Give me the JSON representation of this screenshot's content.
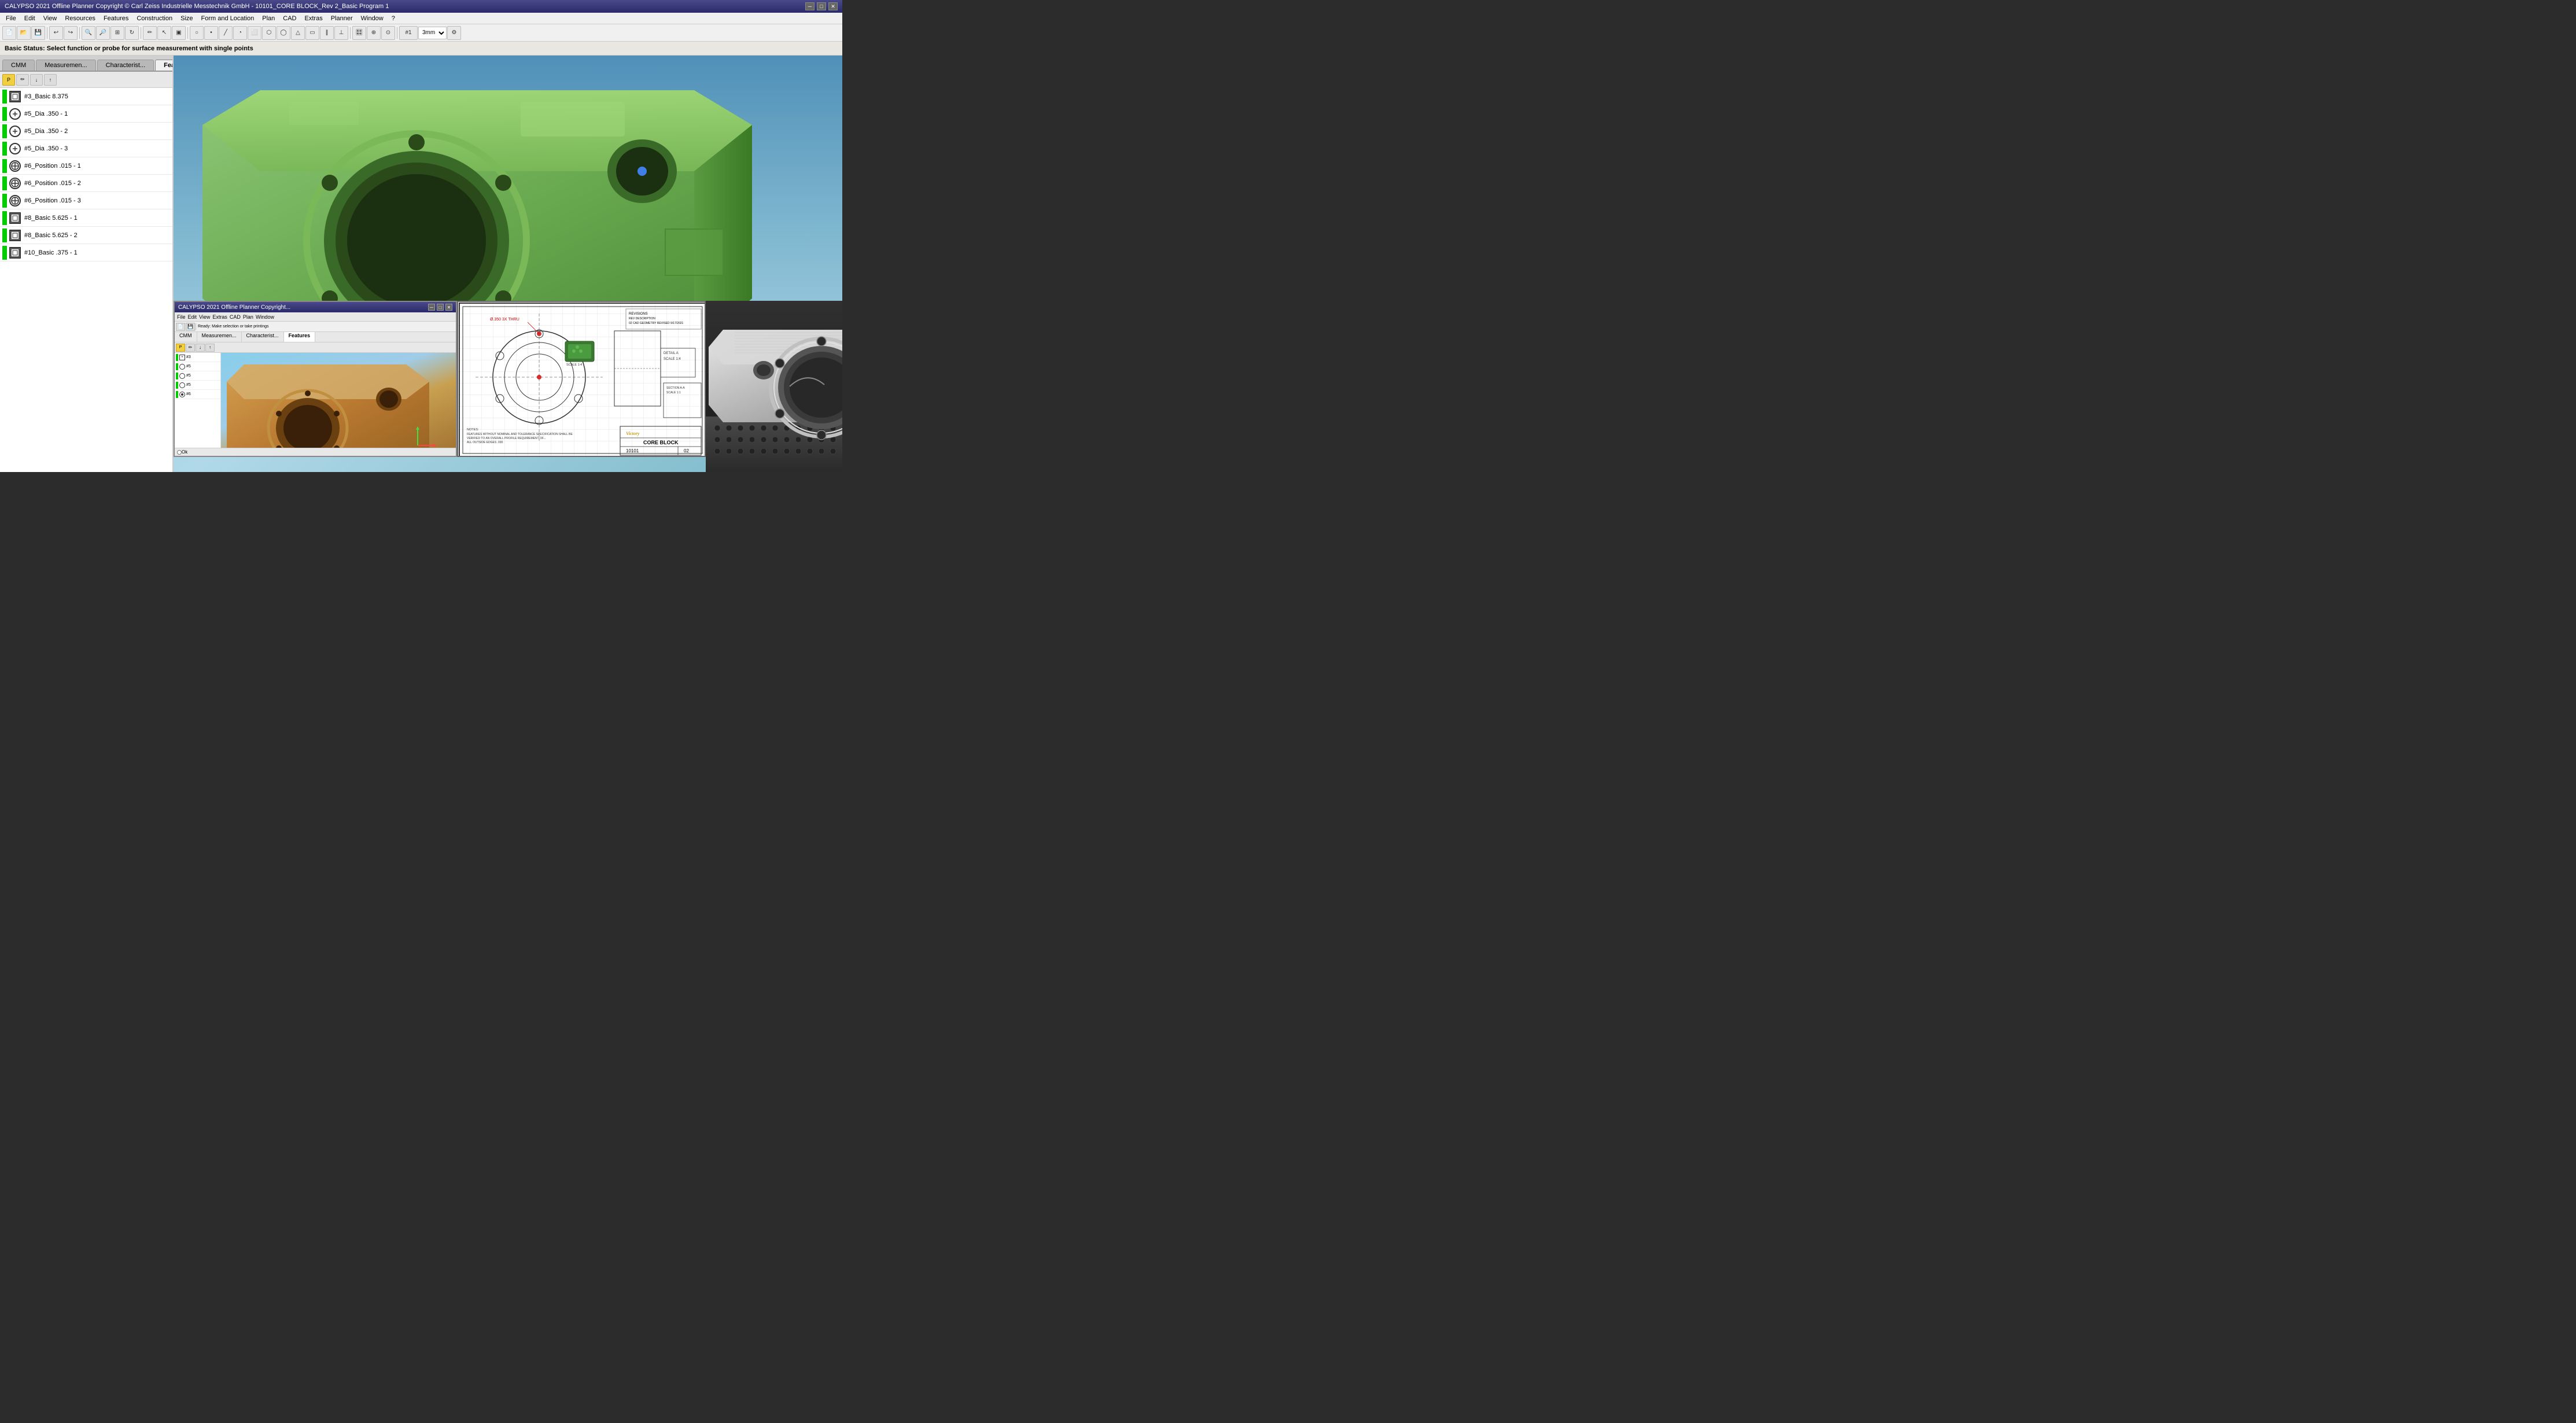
{
  "titlebar": {
    "text": "CALYPSO 2021 Offline Planner Copyright © Carl Zeiss Industrielle Messtechnik GmbH - 10101_CORE BLOCK_Rev 2_Basic Program 1"
  },
  "menubar": {
    "items": [
      "File",
      "Edit",
      "View",
      "Resources",
      "Features",
      "Construction",
      "Size",
      "Form and Location",
      "Plan",
      "CAD",
      "Extras",
      "Planner",
      "Window",
      "?"
    ]
  },
  "statusbar": {
    "text": "Basic Status: Select function or probe for surface measurement with single points"
  },
  "tabs": {
    "items": [
      "CMM",
      "Measuremen...",
      "Characterist...",
      "Features"
    ],
    "active": 3
  },
  "toolbar": {
    "probe_label": "#1",
    "probe_size": "3mm"
  },
  "features": [
    {
      "id": 1,
      "label": "#3_Basic 8.375",
      "type": "basic",
      "status": "green"
    },
    {
      "id": 2,
      "label": "#5_Dia .350 - 1",
      "type": "circle",
      "status": "green"
    },
    {
      "id": 3,
      "label": "#5_Dia .350 - 2",
      "type": "circle",
      "status": "green"
    },
    {
      "id": 4,
      "label": "#5_Dia .350 - 3",
      "type": "circle",
      "status": "green"
    },
    {
      "id": 5,
      "label": "#6_Position .015 - 1",
      "type": "position",
      "status": "green"
    },
    {
      "id": 6,
      "label": "#6_Position .015 - 2",
      "type": "position",
      "status": "green"
    },
    {
      "id": 7,
      "label": "#6_Position .015 - 3",
      "type": "position",
      "status": "green"
    },
    {
      "id": 8,
      "label": "#8_Basic 5.625 - 1",
      "type": "basic",
      "status": "green"
    },
    {
      "id": 9,
      "label": "#8_Basic 5.625 - 2",
      "type": "basic",
      "status": "green"
    },
    {
      "id": 10,
      "label": "#10_Basic .375 - 1",
      "type": "basic",
      "status": "green"
    }
  ],
  "subwindow": {
    "title": "CALYPSO 2021 Offline Planner Copyright...",
    "tabs": [
      "CMM",
      "Measuremen...",
      "Characterist...",
      "Features"
    ],
    "active_tab": 3
  },
  "cad_drawing": {
    "title": "CORE BLOCK",
    "revision": "02",
    "part_number": "10101",
    "scale": "1:1",
    "company": "Victory",
    "notes": "FEATURES WITHOUT NOMINAL AND TOLERANCE SPECIFICATION SHALL BE\nVERIFIED TO AN OVERALL PROFILE REQUIREMENT OF...\nALL OUTSIDE EDGES .030"
  },
  "photo": {
    "description": "Machined aluminum CORE BLOCK part photo"
  },
  "axis": {
    "x_color": "#ff4444",
    "y_color": "#44ff44",
    "z_color": "#4444ff"
  },
  "victory_label": "Victory CORE BLOCK"
}
